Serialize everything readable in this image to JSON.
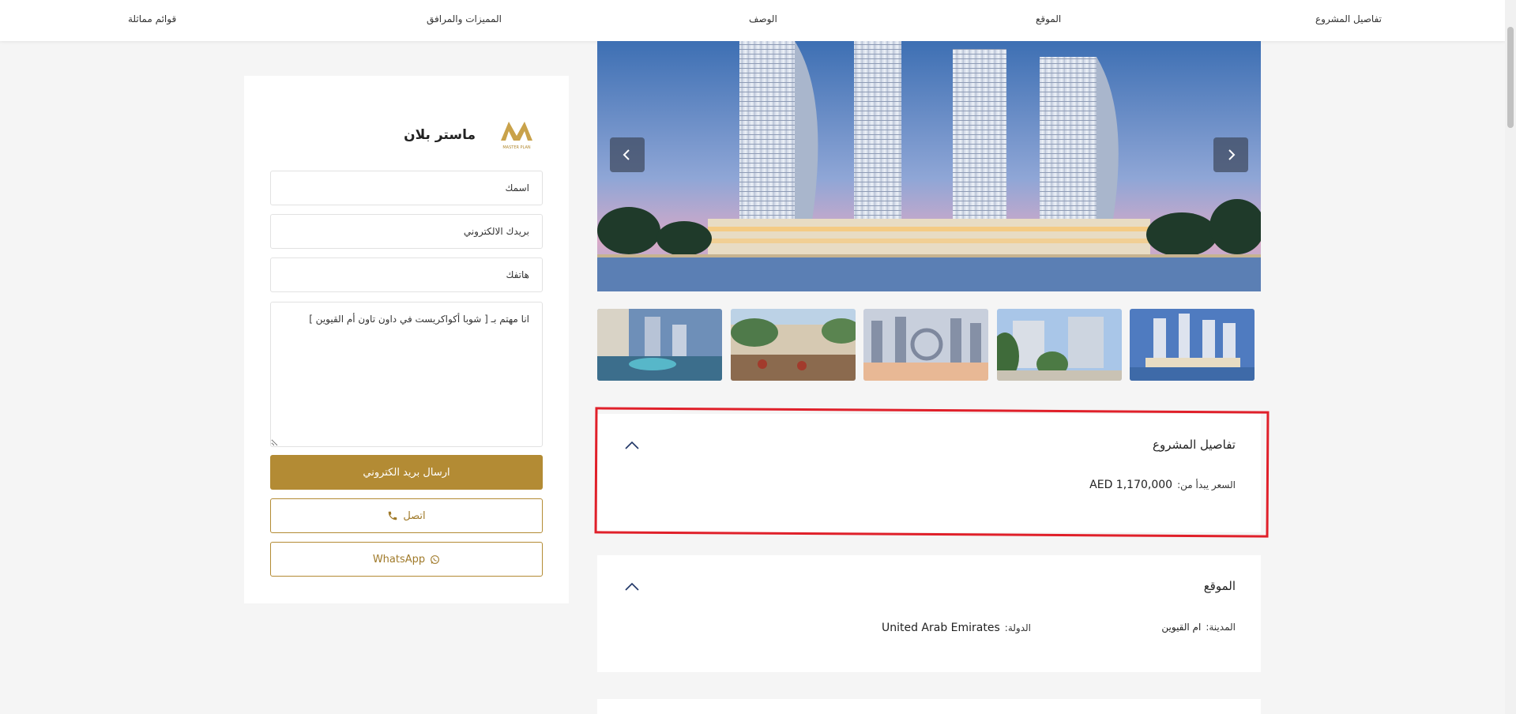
{
  "nav": {
    "items": [
      "تفاصيل المشروع",
      "الموقع",
      "الوصف",
      "المميزات والمرافق",
      "قوائم مماثلة"
    ]
  },
  "contact": {
    "brand_name": "ماستر بلان",
    "logo_caption": "MASTER PLAN",
    "name_placeholder": "اسمك",
    "email_placeholder": "بريدك الالكتروني",
    "phone_placeholder": "هاتفك",
    "message": "انا مهتم بـ [ شوبا أكواكريست في داون تاون أم القيوين ]",
    "send_label": "ارسال بريد الكتروني",
    "call_label": "اتصل",
    "whatsapp_label": "WhatsApp"
  },
  "icons": {
    "prev": "chevron-left-icon",
    "next": "chevron-right-icon",
    "phone": "phone-icon",
    "whatsapp": "whatsapp-icon",
    "collapse": "chevron-up-icon"
  },
  "colors": {
    "accent": "#b38b34",
    "highlight": "#e0202a"
  },
  "details": {
    "title": "تفاصيل المشروع",
    "price_label": "السعر يبدأ من:",
    "price_value": "AED 1,170,000"
  },
  "location": {
    "title": "الموقع",
    "city_label": "المدينة:",
    "city_value": "ام القيوين",
    "country_label": "الدولة:",
    "country_value": "United Arab Emirates"
  }
}
